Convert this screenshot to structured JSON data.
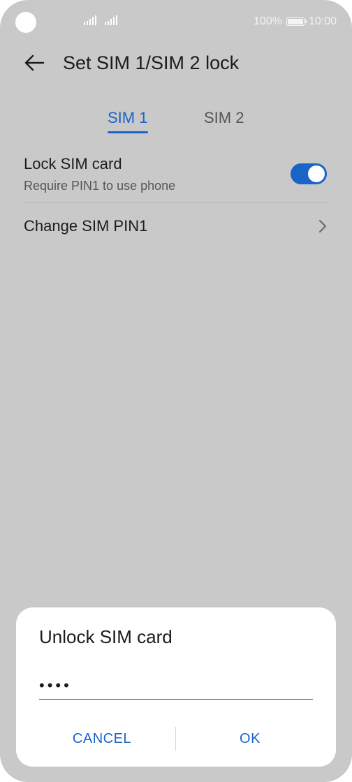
{
  "status_bar": {
    "battery_text": "100%",
    "time": "10:00",
    "icons": [
      "camera-cutout",
      "signal-sim1-icon",
      "signal-sim2-icon",
      "battery-icon"
    ]
  },
  "app_bar": {
    "back_icon": "arrow-left-icon",
    "title": "Set SIM 1/SIM 2 lock"
  },
  "tabs": [
    {
      "label": "SIM 1",
      "active": true
    },
    {
      "label": "SIM 2",
      "active": false
    }
  ],
  "settings": {
    "lock_sim": {
      "title": "Lock SIM card",
      "subtitle": "Require PIN1 to use phone",
      "enabled": true
    },
    "change_pin": {
      "title": "Change SIM PIN1",
      "icon": "chevron-right-icon"
    }
  },
  "dialog": {
    "title": "Unlock SIM card",
    "pin_value": "••••",
    "cancel_label": "CANCEL",
    "ok_label": "OK"
  },
  "colors": {
    "accent": "#1a64c8",
    "screen_dim": "#c9c9c9",
    "dialog_bg": "#ffffff"
  }
}
